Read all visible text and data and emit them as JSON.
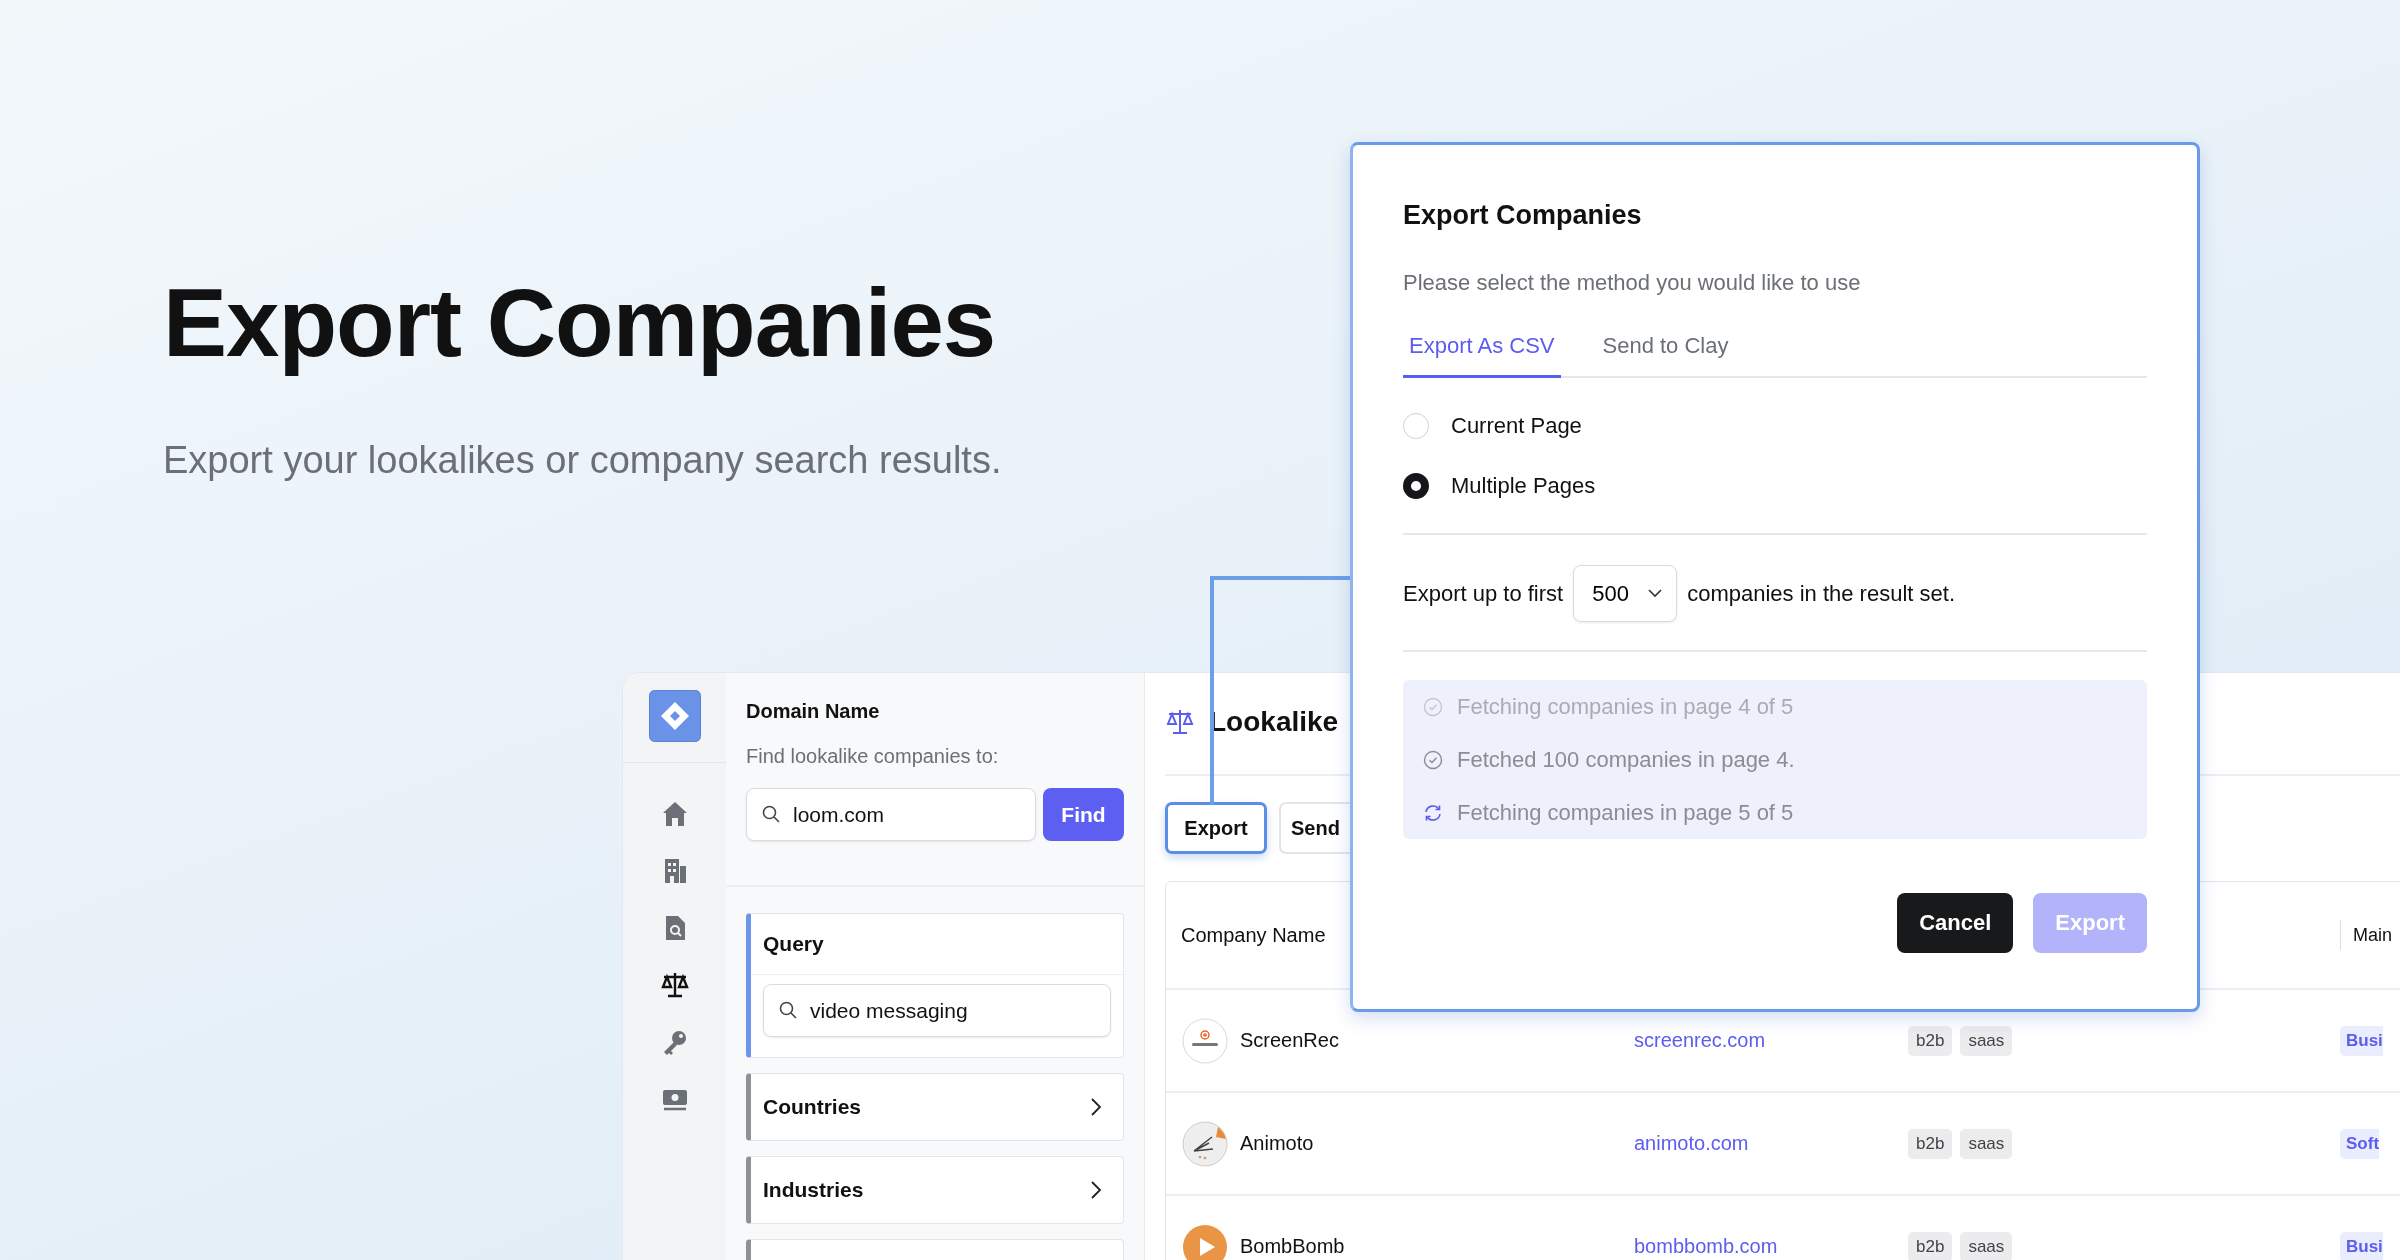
{
  "hero": {
    "title": "Export Companies",
    "subtitle": "Export your lookalikes or company search results."
  },
  "nav": [
    {
      "kind": "home",
      "selected": false
    },
    {
      "kind": "building",
      "selected": false
    },
    {
      "kind": "document",
      "selected": false
    },
    {
      "kind": "scale",
      "selected": true
    },
    {
      "kind": "key",
      "selected": false
    },
    {
      "kind": "cash",
      "selected": false
    }
  ],
  "domain_panel": {
    "title": "Domain Name",
    "label": "Find lookalike companies to:",
    "value": "loom.com",
    "button": "Find"
  },
  "filters": [
    {
      "label": "Query",
      "expanded": true,
      "value": "video messaging"
    },
    {
      "label": "Countries",
      "expanded": false
    },
    {
      "label": "Industries",
      "expanded": false
    },
    {
      "expanded": false
    }
  ],
  "main": {
    "title": "Lookalike",
    "buttons": [
      {
        "label": "Export",
        "focused": true
      },
      {
        "label": "Send",
        "focused": false
      }
    ]
  },
  "table": {
    "columns": [
      "Company Name",
      "Main"
    ],
    "rows": [
      {
        "name": "ScreenRec",
        "kind": "screenrec",
        "domain": "screenrec.com",
        "tags": [
          "b2b",
          "saas"
        ],
        "column_4": "Busi"
      },
      {
        "name": "Animoto",
        "kind": "animoto",
        "domain": "animoto.com",
        "tags": [
          "b2b",
          "saas"
        ],
        "column_4": "Soft"
      },
      {
        "name": "BombBomb",
        "kind": "bombbomb",
        "domain": "bombbomb.com",
        "tags": [
          "b2b",
          "saas"
        ],
        "column_4": "Busi"
      }
    ]
  },
  "dialog": {
    "title": "Export Companies",
    "subtitle": "Please select the method you would like to use",
    "tabs": [
      {
        "label": "Export As CSV",
        "selected": true
      },
      {
        "label": "Send to Clay",
        "selected": false
      }
    ],
    "options": [
      {
        "label": "Current Page",
        "selected": false
      },
      {
        "label": "Multiple Pages",
        "selected": true
      }
    ],
    "limit": {
      "prefix": "Export up to first",
      "value": "500",
      "suffix": "companies in the result set."
    },
    "progress": [
      {
        "text": "Fetching companies in page 4 of 5",
        "kind": "done",
        "faded": true
      },
      {
        "text": "Fetched 100 companies in page 4.",
        "kind": "done",
        "faded": false
      },
      {
        "text": "Fetching companies in page 5 of 5",
        "kind": "loading",
        "faded": false
      }
    ],
    "buttons": [
      {
        "label": "Cancel",
        "kind": "dark",
        "disabled": false
      },
      {
        "label": "Export",
        "kind": "primary",
        "disabled": true
      }
    ]
  }
}
